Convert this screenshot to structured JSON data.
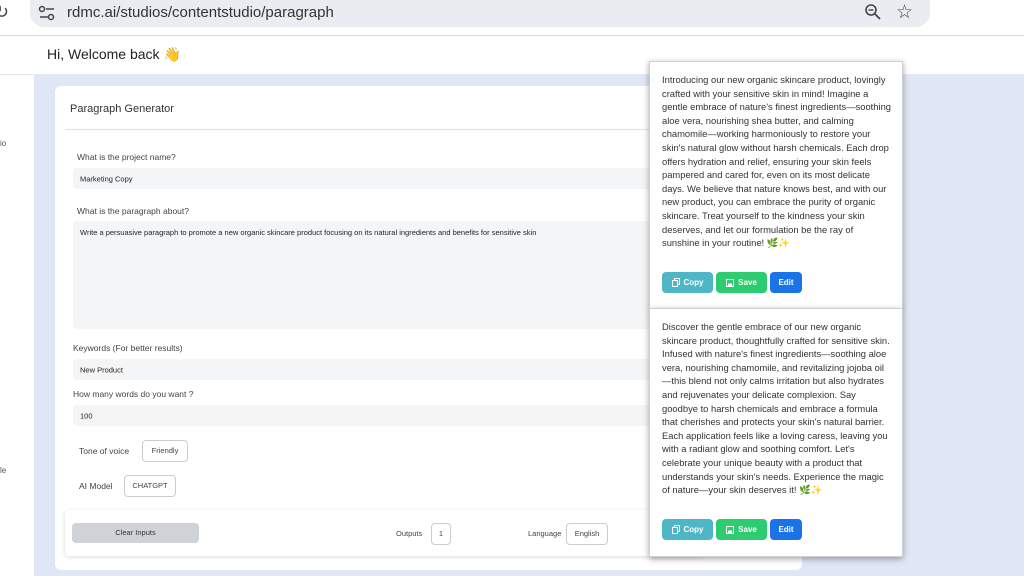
{
  "browser": {
    "url": "rdmc.ai/studios/contentstudio/paragraph"
  },
  "header": {
    "greeting": "Hi, Welcome back 👋"
  },
  "sidebar": {
    "items": [
      {
        "label": "io"
      },
      {
        "label": "le"
      }
    ]
  },
  "form": {
    "title": "Paragraph Generator",
    "project_label": "What is the project name?",
    "project_value": "Marketing Copy",
    "about_label": "What is the paragraph about?",
    "about_value": "Write a persuasive paragraph to promote a new organic skincare product focusing on its natural ingredients and benefits for sensitive skin",
    "keywords_label": "Keywords (For better results)",
    "keywords_value": "New Product",
    "words_label": "How many words do you want ?",
    "words_value": "100",
    "tone_label": "Tone of voice",
    "tone_value": "Friendly",
    "model_label": "AI Model",
    "model_value": "CHATGPT"
  },
  "footer": {
    "clear_label": "Clear Inputs",
    "outputs_label": "Outputs",
    "outputs_value": "1",
    "language_label": "Language",
    "language_value": "English"
  },
  "outputs": [
    {
      "text": "Introducing our new organic skincare product, lovingly crafted with your sensitive skin in mind! Imagine a gentle embrace of nature's finest ingredients—soothing aloe vera, nourishing shea butter, and calming chamomile—working harmoniously to restore your skin's natural glow without harsh chemicals. Each drop offers hydration and relief, ensuring your skin feels pampered and cared for, even on its most delicate days. We believe that nature knows best, and with our new product, you can embrace the purity of organic skincare. Treat yourself to the kindness your skin deserves, and let our formulation be the ray of sunshine in your routine! 🌿✨",
      "copy_label": "Copy",
      "save_label": "Save",
      "edit_label": "Edit"
    },
    {
      "text": "Discover the gentle embrace of our new organic skincare product, thoughtfully crafted for sensitive skin. Infused with nature's finest ingredients—soothing aloe vera, nourishing chamomile, and revitalizing jojoba oil—this blend not only calms irritation but also hydrates and rejuvenates your delicate complexion. Say goodbye to harsh chemicals and embrace a formula that cherishes and protects your skin's natural barrier. Each application feels like a loving caress, leaving you with a radiant glow and soothing comfort. Let's celebrate your unique beauty with a product that understands your skin's needs. Experience the magic of nature—your skin deserves it! 🌿✨",
      "copy_label": "Copy",
      "save_label": "Save",
      "edit_label": "Edit"
    }
  ],
  "colors": {
    "copy": "#4fb6c6",
    "save": "#2ecc71",
    "edit": "#1b73e8",
    "page_bg": "#dfe7f7"
  }
}
